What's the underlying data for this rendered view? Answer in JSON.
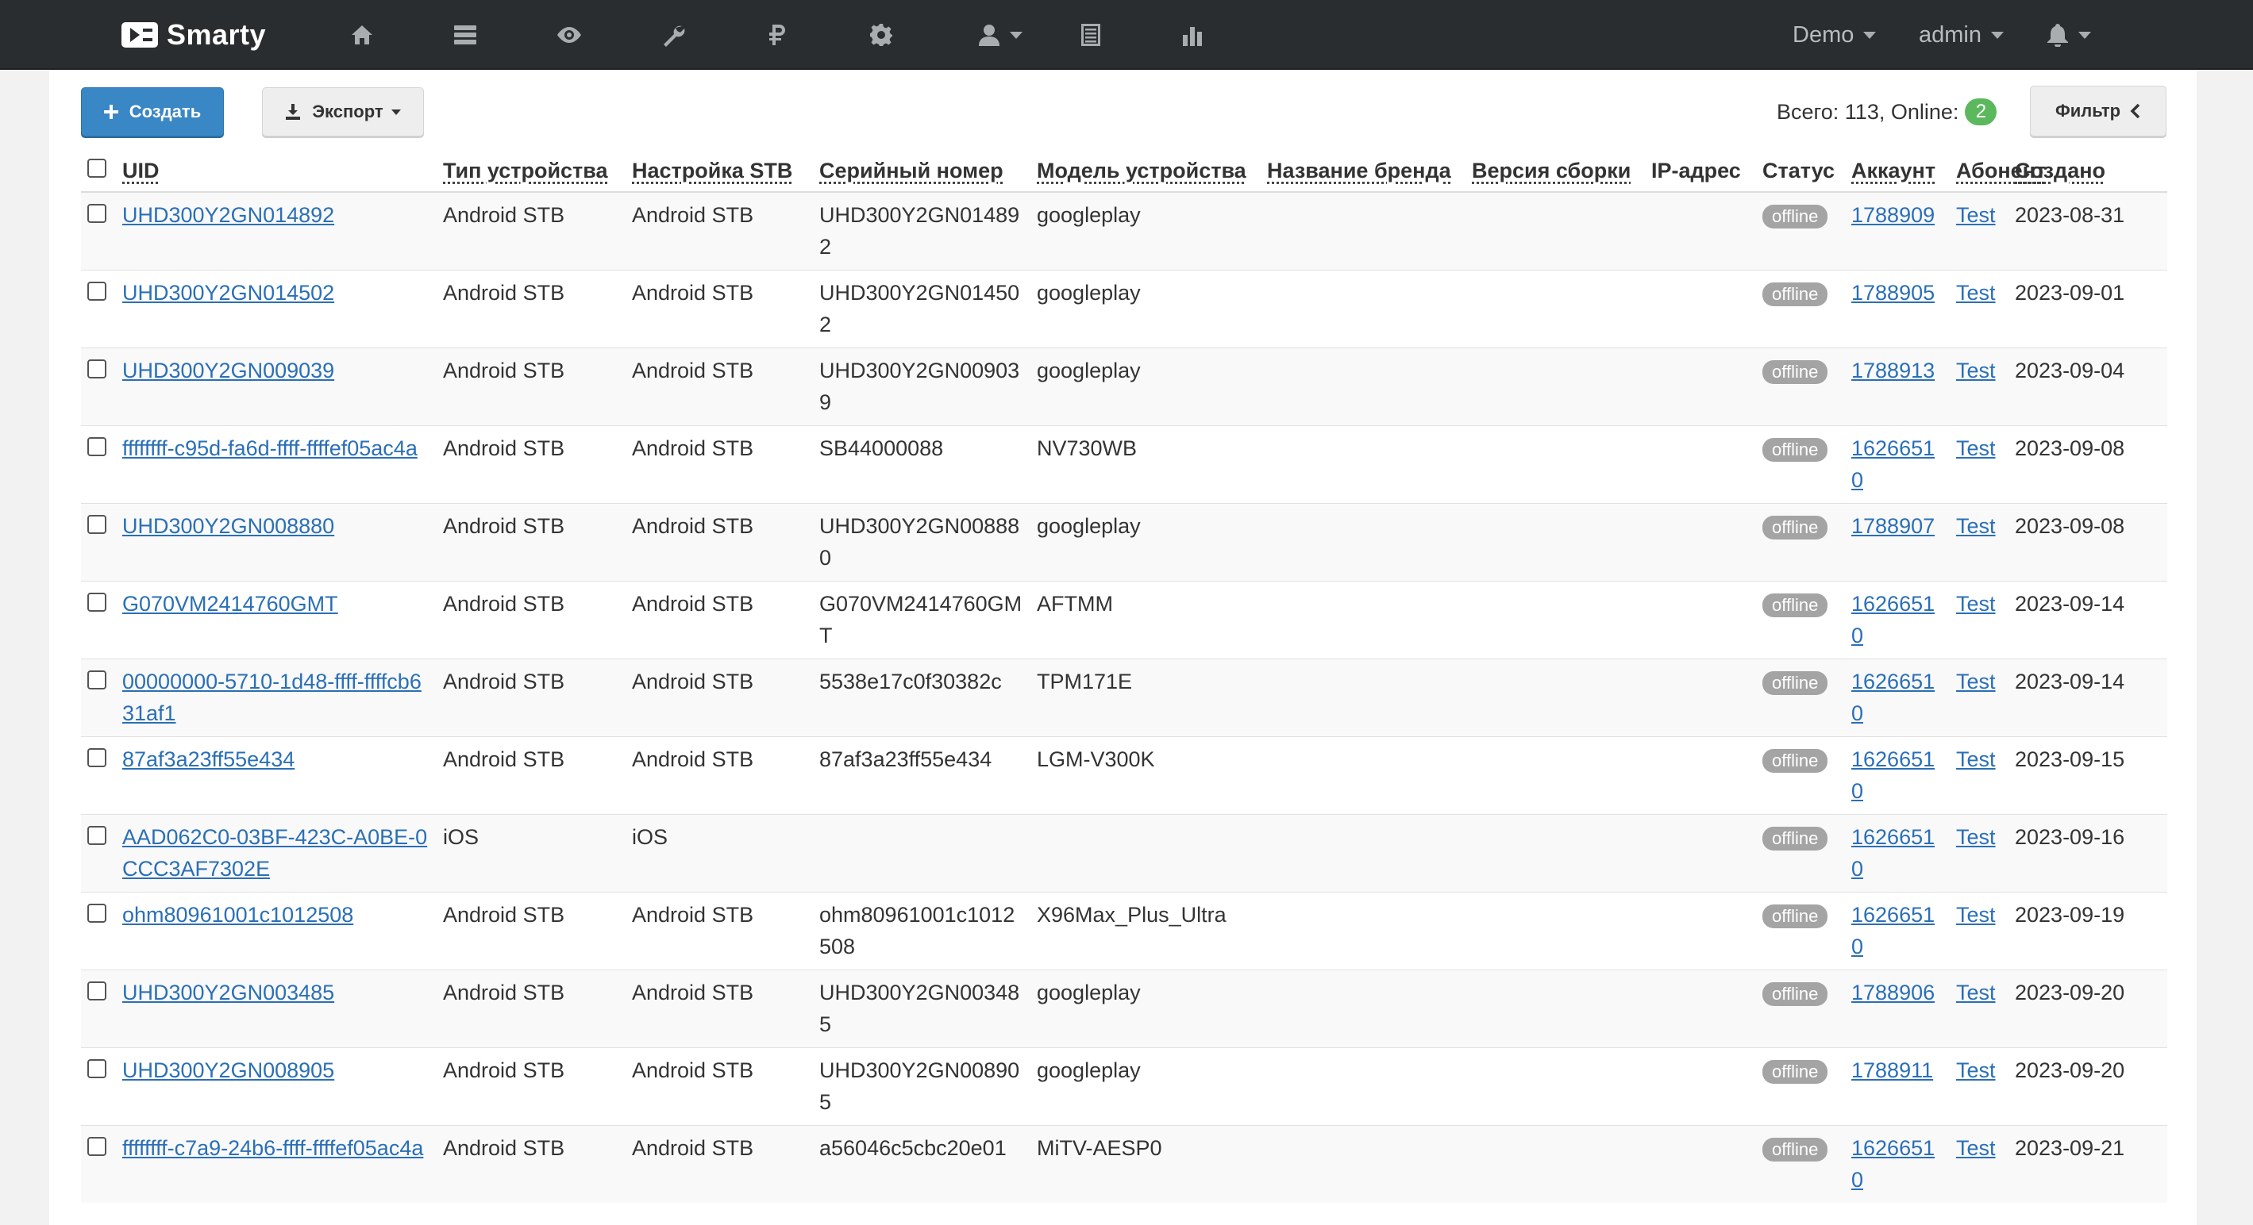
{
  "brand": {
    "name": "Smarty"
  },
  "nav": {
    "icons": [
      "home-icon",
      "server-icon",
      "eye-icon",
      "wrench-icon",
      "ruble-icon",
      "gear-icon",
      "user-icon",
      "list-icon",
      "bar-chart-icon"
    ],
    "demo_label": "Demo",
    "admin_label": "admin"
  },
  "toolbar": {
    "create_label": "Создать",
    "export_label": "Экспорт",
    "filter_label": "Фильтр",
    "totals_label": "Всего: 113, Online:",
    "online_count": "2"
  },
  "table": {
    "columns": [
      "UID",
      "Тип устройства",
      "Настройка STB",
      "Серийный номер",
      "Модель устройства",
      "Название бренда",
      "Версия сборки",
      "IP-адрес",
      "Статус",
      "Аккаунт",
      "Абонент",
      "Создано"
    ],
    "rows": [
      {
        "uid": "UHD300Y2GN014892",
        "type": "Android STB",
        "stb": "Android STB",
        "serial": "UHD300Y2GN014892",
        "model": "googleplay",
        "brand": "",
        "build": "",
        "ip": "",
        "status": "offline",
        "account": "1788909",
        "subscriber": "Test",
        "created": "2023-08-31"
      },
      {
        "uid": "UHD300Y2GN014502",
        "type": "Android STB",
        "stb": "Android STB",
        "serial": "UHD300Y2GN014502",
        "model": "googleplay",
        "brand": "",
        "build": "",
        "ip": "",
        "status": "offline",
        "account": "1788905",
        "subscriber": "Test",
        "created": "2023-09-01"
      },
      {
        "uid": "UHD300Y2GN009039",
        "type": "Android STB",
        "stb": "Android STB",
        "serial": "UHD300Y2GN009039",
        "model": "googleplay",
        "brand": "",
        "build": "",
        "ip": "",
        "status": "offline",
        "account": "1788913",
        "subscriber": "Test",
        "created": "2023-09-04"
      },
      {
        "uid": "ffffffff-c95d-fa6d-ffff-ffffef05ac4a",
        "type": "Android STB",
        "stb": "Android STB",
        "serial": "SB44000088",
        "model": "NV730WB",
        "brand": "",
        "build": "",
        "ip": "",
        "status": "offline",
        "account": "16266510",
        "subscriber": "Test",
        "created": "2023-09-08"
      },
      {
        "uid": "UHD300Y2GN008880",
        "type": "Android STB",
        "stb": "Android STB",
        "serial": "UHD300Y2GN008880",
        "model": "googleplay",
        "brand": "",
        "build": "",
        "ip": "",
        "status": "offline",
        "account": "1788907",
        "subscriber": "Test",
        "created": "2023-09-08"
      },
      {
        "uid": "G070VM2414760GMT",
        "type": "Android STB",
        "stb": "Android STB",
        "serial": "G070VM2414760GMT",
        "model": "AFTMM",
        "brand": "",
        "build": "",
        "ip": "",
        "status": "offline",
        "account": "16266510",
        "subscriber": "Test",
        "created": "2023-09-14"
      },
      {
        "uid": "00000000-5710-1d48-ffff-ffffcb631af1",
        "type": "Android STB",
        "stb": "Android STB",
        "serial": "5538e17c0f30382c",
        "model": "TPM171E",
        "brand": "",
        "build": "",
        "ip": "",
        "status": "offline",
        "account": "16266510",
        "subscriber": "Test",
        "created": "2023-09-14"
      },
      {
        "uid": "87af3a23ff55e434",
        "type": "Android STB",
        "stb": "Android STB",
        "serial": "87af3a23ff55e434",
        "model": "LGM-V300K",
        "brand": "",
        "build": "",
        "ip": "",
        "status": "offline",
        "account": "16266510",
        "subscriber": "Test",
        "created": "2023-09-15"
      },
      {
        "uid": "AAD062C0-03BF-423C-A0BE-0CCC3AF7302E",
        "type": "iOS",
        "stb": "iOS",
        "serial": "",
        "model": "",
        "brand": "",
        "build": "",
        "ip": "",
        "status": "offline",
        "account": "16266510",
        "subscriber": "Test",
        "created": "2023-09-16"
      },
      {
        "uid": "ohm80961001c1012508",
        "type": "Android STB",
        "stb": "Android STB",
        "serial": "ohm80961001c1012508",
        "model": "X96Max_Plus_Ultra",
        "brand": "",
        "build": "",
        "ip": "",
        "status": "offline",
        "account": "16266510",
        "subscriber": "Test",
        "created": "2023-09-19"
      },
      {
        "uid": "UHD300Y2GN003485",
        "type": "Android STB",
        "stb": "Android STB",
        "serial": "UHD300Y2GN003485",
        "model": "googleplay",
        "brand": "",
        "build": "",
        "ip": "",
        "status": "offline",
        "account": "1788906",
        "subscriber": "Test",
        "created": "2023-09-20"
      },
      {
        "uid": "UHD300Y2GN008905",
        "type": "Android STB",
        "stb": "Android STB",
        "serial": "UHD300Y2GN008905",
        "model": "googleplay",
        "brand": "",
        "build": "",
        "ip": "",
        "status": "offline",
        "account": "1788911",
        "subscriber": "Test",
        "created": "2023-09-20"
      },
      {
        "uid": "ffffffff-c7a9-24b6-ffff-ffffef05ac4a",
        "type": "Android STB",
        "stb": "Android STB",
        "serial": "a56046c5cbc20e01",
        "model": "MiTV-AESP0",
        "brand": "",
        "build": "",
        "ip": "",
        "status": "offline",
        "account": "16266510",
        "subscriber": "Test",
        "created": "2023-09-21"
      }
    ]
  },
  "colors": {
    "navbar": "#2a2d2f",
    "primary": "#3a87c6",
    "link": "#2a6fb7",
    "online_badge": "#5cb85c",
    "offline_badge": "#a4a4a4"
  }
}
